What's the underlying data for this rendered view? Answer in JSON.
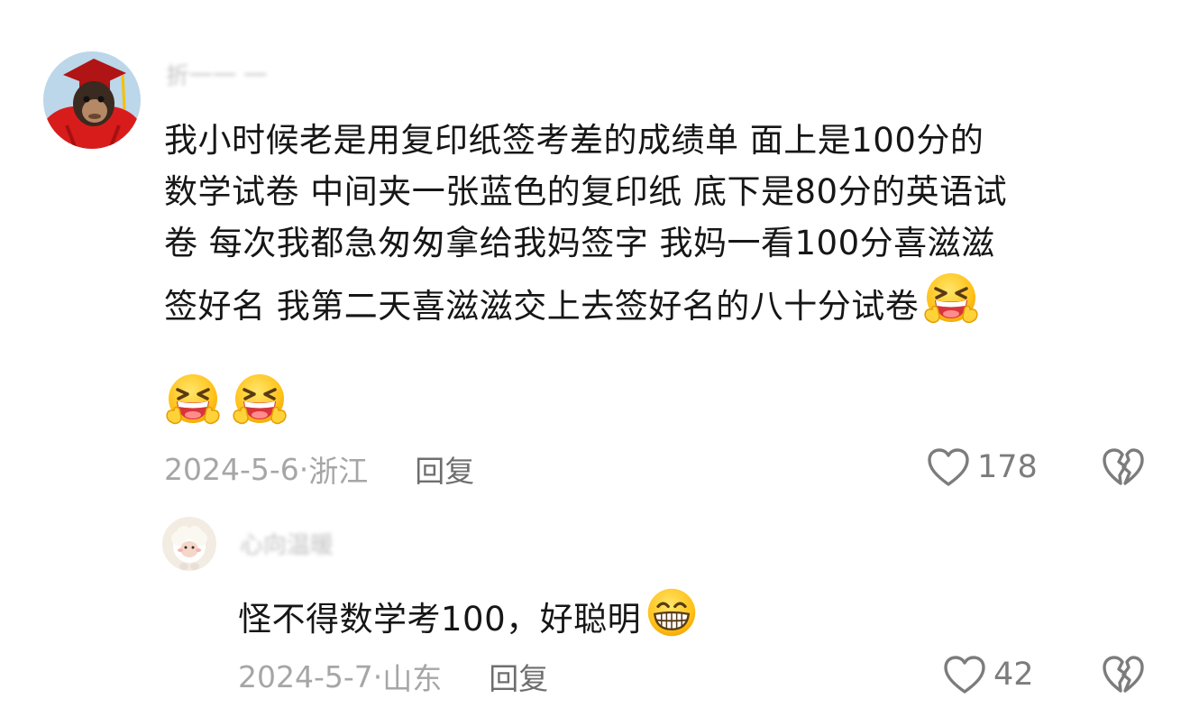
{
  "comments": [
    {
      "username": "折一一 一",
      "text_lines": [
        "我小时候老是用复印纸签考差的成绩单 面上是100分的",
        "数学试卷 中间夹一张蓝色的复印纸 底下是80分的英语试",
        "卷 每次我都急匆匆拿给我妈签字 我妈一看100分喜滋滋",
        "签好名 我第二天喜滋滋交上去签好名的八十分试卷"
      ],
      "emoji": "laughing-tears-emoji",
      "date": "2024-5-6",
      "location": "浙江",
      "reply_label": "回复",
      "like_count": "178"
    },
    {
      "username": "心向温暖",
      "text": "怪不得数学考100，好聪明",
      "emoji": "grinning-emoji",
      "date": "2024-5-7",
      "location": "山东",
      "reply_label": "回复",
      "like_count": "42"
    }
  ],
  "separator": "·",
  "colors": {
    "text": "#161616",
    "meta": "#a6a6a6",
    "reply": "#6e6e6e",
    "icon": "#7c7c7c",
    "emoji_face": "#ffc21a",
    "mouth": "#d8343b"
  }
}
